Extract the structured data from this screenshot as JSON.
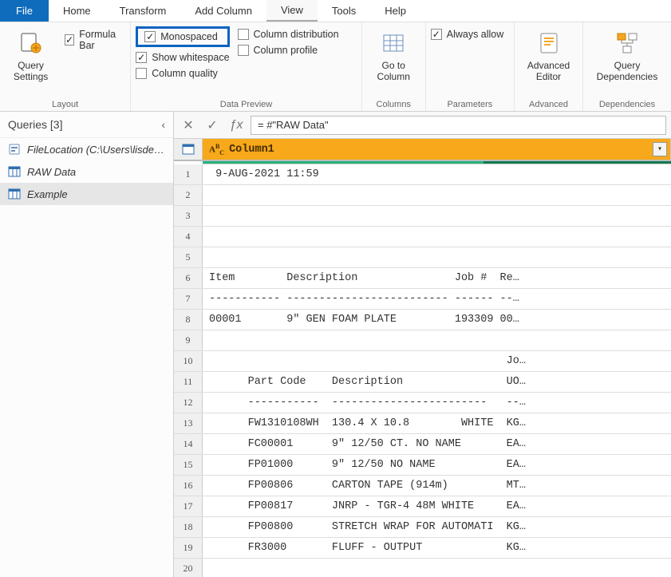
{
  "menu": {
    "file": "File",
    "tabs": [
      "Home",
      "Transform",
      "Add Column",
      "View",
      "Tools",
      "Help"
    ],
    "active": "View"
  },
  "ribbon": {
    "layout": {
      "query_settings": "Query\nSettings",
      "formula_bar": "Formula Bar",
      "group_label": "Layout"
    },
    "data_preview": {
      "monospaced": "Monospaced",
      "show_whitespace": "Show whitespace",
      "column_quality": "Column quality",
      "column_distribution": "Column distribution",
      "column_profile": "Column profile",
      "group_label": "Data Preview"
    },
    "columns": {
      "goto_column": "Go to\nColumn",
      "group_label": "Columns"
    },
    "parameters": {
      "always_allow": "Always allow",
      "group_label": "Parameters"
    },
    "advanced": {
      "advanced_editor": "Advanced\nEditor",
      "group_label": "Advanced"
    },
    "dependencies": {
      "query_dependencies": "Query\nDependencies",
      "group_label": "Dependencies"
    }
  },
  "queries_panel": {
    "title": "Queries [3]",
    "items": [
      {
        "label": "FileLocation (C:\\Users\\lisde…",
        "kind": "param"
      },
      {
        "label": "RAW Data",
        "kind": "table"
      },
      {
        "label": "Example",
        "kind": "table",
        "active": true
      }
    ]
  },
  "formula_bar": {
    "value": "= #\"RAW Data\""
  },
  "grid": {
    "column_type_label": "ABC",
    "column_name": "Column1",
    "rows": [
      " 9-AUG-2021 11:59",
      "",
      "",
      "",
      "",
      "Item        Description               Job #  Re…",
      "----------- ------------------------- ------ --…",
      "00001       9\" GEN FOAM PLATE         193309 00…",
      "",
      "                                              Jo…",
      "      Part Code    Description                UO…",
      "      -----------  ------------------------   --…",
      "      FW1310108WH  130.4 X 10.8        WHITE  KG…",
      "      FC00001      9\" 12/50 CT. NO NAME       EA…",
      "      FP01000      9\" 12/50 NO NAME           EA…",
      "      FP00806      CARTON TAPE (914m)         MT…",
      "      FP00817      JNRP - TGR-4 48M WHITE     EA…",
      "      FP00800      STRETCH WRAP FOR AUTOMATI  KG…",
      "      FR3000       FLUFF - OUTPUT             KG…",
      ""
    ]
  }
}
